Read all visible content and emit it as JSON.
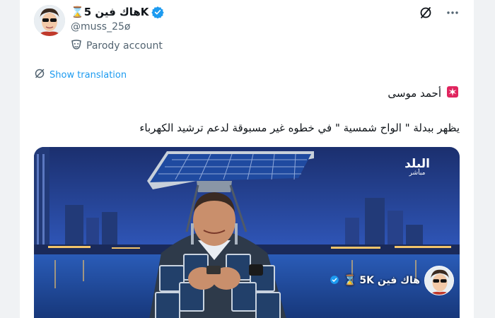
{
  "post": {
    "display_name": "Kهاك فين 5⌛",
    "handle": "@muss_25ø",
    "account_label": "Parody account",
    "show_translation": "Show translation",
    "line1": "أحمد موسى",
    "line2": "يظهر ببدلة \" الواح شمسية \" في خطوه غير مسبوقة لدعم ترشيد الكهرباء"
  },
  "media": {
    "channel_name": "البلد",
    "channel_sub": "مباشر",
    "watermark": "هاك فين 5K ⌛"
  },
  "icons": {
    "verified": "verified-badge-icon",
    "grok": "grok-icon",
    "more": "more-icon",
    "parody": "parody-mask-icon",
    "translate": "translate-icon",
    "siren": "siren-emoji-icon"
  },
  "colors": {
    "accent": "#1d9bf0",
    "text": "#0f1419",
    "secondary": "#536471"
  }
}
